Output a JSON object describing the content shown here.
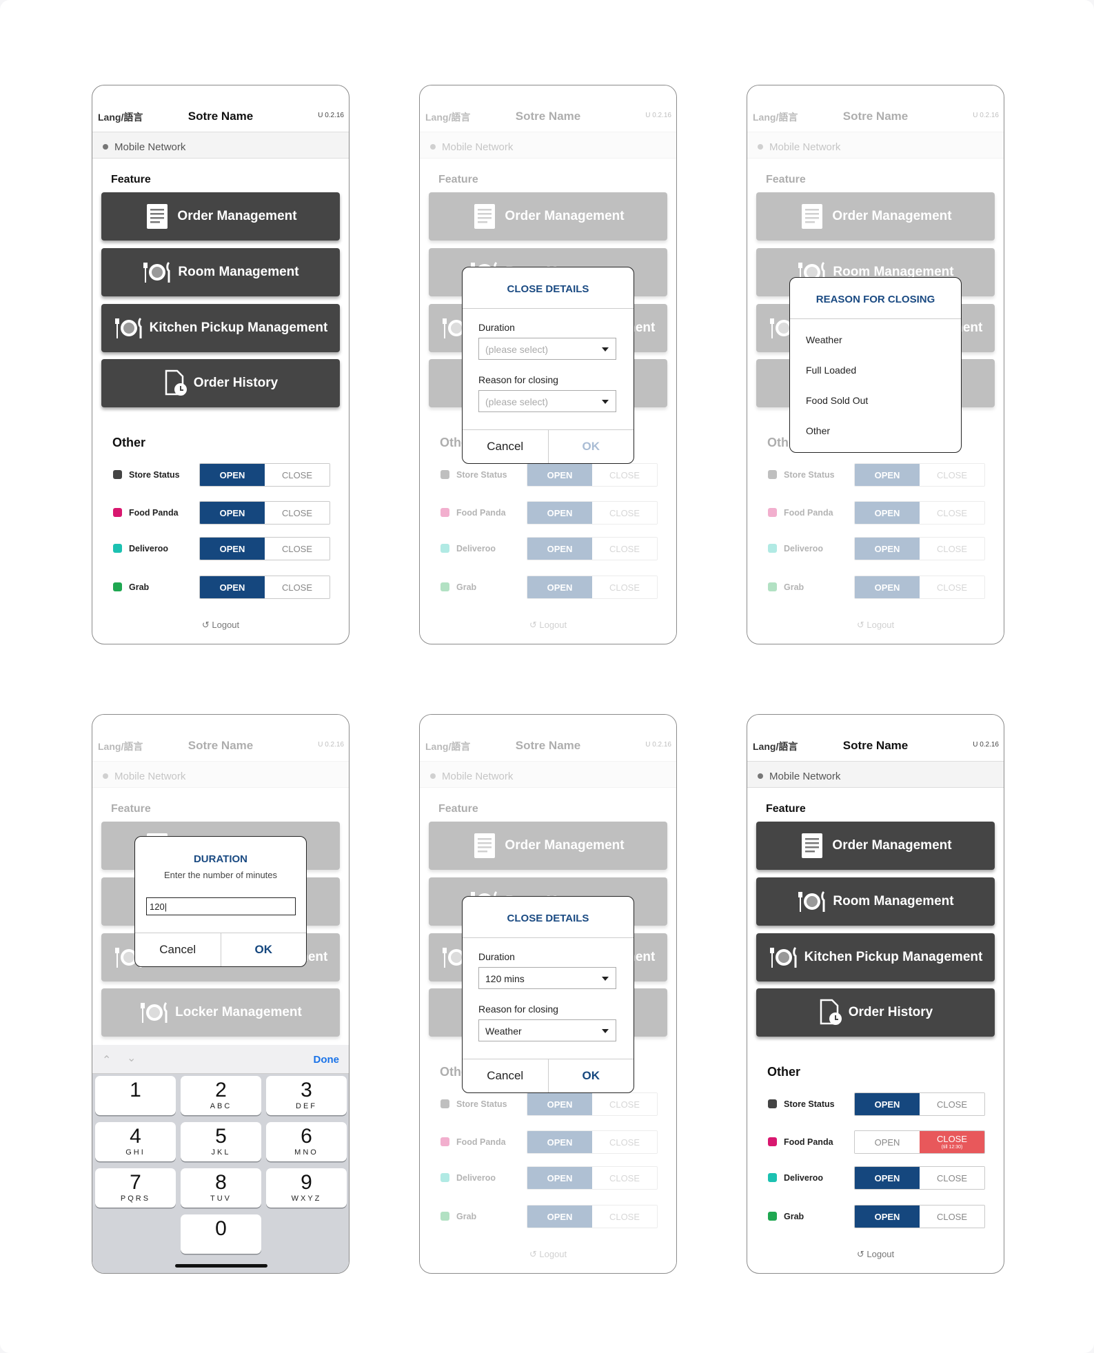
{
  "header": {
    "lang": "Lang/語言",
    "store": "Sotre Name",
    "version": "U 0.2.16"
  },
  "network": "Mobile Network",
  "feature_title": "Feature",
  "features": [
    "Order Management",
    "Room Management",
    "Kitchen Pickup Management",
    "Order History"
  ],
  "locker": "Locker Management",
  "other_title": "Other",
  "statuses": [
    {
      "label": "Store Status",
      "icon": "store-icon",
      "color": "#444444"
    },
    {
      "label": "Food Panda",
      "icon": "foodpanda-icon",
      "color": "#d8176f"
    },
    {
      "label": "Deliveroo",
      "icon": "deliveroo-icon",
      "color": "#1cc1b1"
    },
    {
      "label": "Grab",
      "icon": "grab-icon",
      "color": "#1fa751"
    }
  ],
  "open_label": "OPEN",
  "close_label": "CLOSE",
  "close_till": "(till 12:30)",
  "logout": "Logout",
  "close_dialog": {
    "title": "CLOSE DETAILS",
    "duration_label": "Duration",
    "reason_label": "Reason for closing",
    "placeholder": "(please select)",
    "duration_value": "120 mins",
    "reason_value": "Weather",
    "cancel": "Cancel",
    "ok": "OK"
  },
  "reason_dialog": {
    "title": "REASON FOR CLOSING",
    "options": [
      "Weather",
      "Full Loaded",
      "Food Sold Out",
      "Other"
    ]
  },
  "duration_dialog": {
    "title": "DURATION",
    "subtitle": "Enter the number of minutes",
    "value": "120|",
    "cancel": "Cancel",
    "ok": "OK"
  },
  "keyboard": {
    "done": "Done",
    "keys": [
      [
        "1",
        ""
      ],
      [
        "2",
        "ABC"
      ],
      [
        "3",
        "DEF"
      ],
      [
        "4",
        "GHI"
      ],
      [
        "5",
        "JKL"
      ],
      [
        "6",
        "MNO"
      ],
      [
        "7",
        "PQRS"
      ],
      [
        "8",
        "TUV"
      ],
      [
        "9",
        "WXYZ"
      ],
      [
        "0",
        ""
      ]
    ]
  },
  "colors": {
    "accent": "#15477e",
    "dark_button": "#454545",
    "closed_red": "#e8585b"
  }
}
